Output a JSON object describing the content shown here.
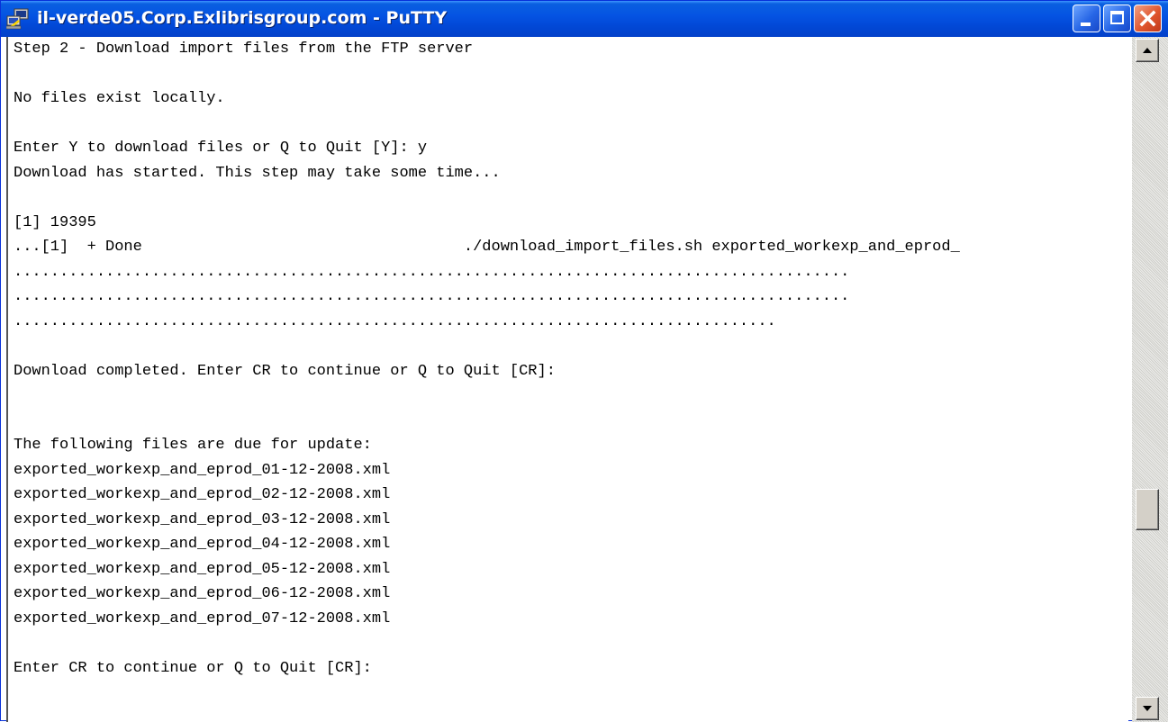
{
  "window": {
    "title": "il-verde05.Corp.Exlibrisgroup.com - PuTTY",
    "icon": "putty-computer-icon",
    "controls": {
      "minimize": "minimize-icon",
      "maximize": "maximize-icon",
      "close": "close-icon"
    },
    "colors": {
      "titlebar": "#0554e3",
      "close_button": "#e0562e"
    }
  },
  "terminal": {
    "lines": [
      "Step 2 - Download import files from the FTP server",
      "",
      "No files exist locally.",
      "",
      "Enter Y to download files or Q to Quit [Y]: y",
      "Download has started. This step may take some time...",
      "",
      "[1] 19395",
      "...[1]  + Done                                   ./download_import_files.sh exported_workexp_and_eprod_",
      "...........................................................................................",
      "...........................................................................................",
      "...................................................................................",
      "",
      "Download completed. Enter CR to continue or Q to Quit [CR]:",
      "",
      "",
      "The following files are due for update:",
      "exported_workexp_and_eprod_01-12-2008.xml",
      "exported_workexp_and_eprod_02-12-2008.xml",
      "exported_workexp_and_eprod_03-12-2008.xml",
      "exported_workexp_and_eprod_04-12-2008.xml",
      "exported_workexp_and_eprod_05-12-2008.xml",
      "exported_workexp_and_eprod_06-12-2008.xml",
      "exported_workexp_and_eprod_07-12-2008.xml",
      "",
      "Enter CR to continue or Q to Quit [CR]:"
    ]
  },
  "scrollbar": {
    "up_icon": "scroll-up-arrow-icon",
    "down_icon": "scroll-down-arrow-icon",
    "position_fraction": 0.72
  }
}
